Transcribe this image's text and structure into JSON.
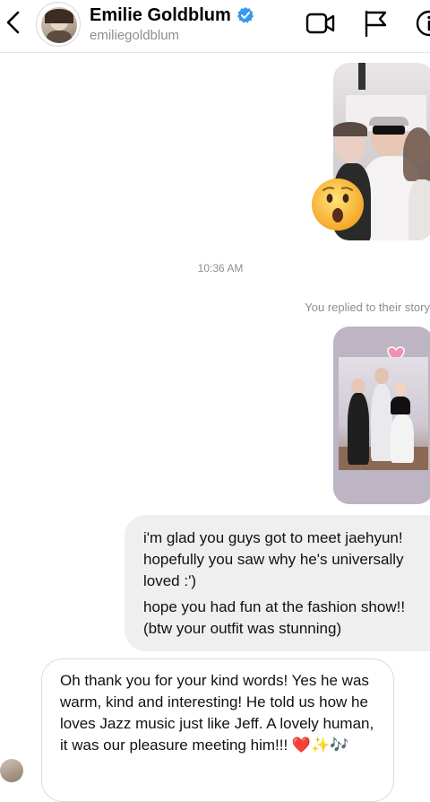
{
  "header": {
    "name": "Emilie Goldblum",
    "handle": "emiliegoldblum",
    "icons": [
      "back-chevron-icon",
      "verified-badge-icon",
      "video-call-icon",
      "flag-icon",
      "info-icon"
    ]
  },
  "thread": {
    "reaction_emoji": "surprised-face",
    "timestamp": "10:36 AM",
    "replied_label": "You replied to their story",
    "outgoing_message": [
      "i'm glad you guys got to meet jaehyun!",
      "hopefully you saw why he's universally",
      "loved :')",
      "hope you had fun at the fashion show!!",
      "(btw your outfit was stunning)"
    ],
    "incoming_message": "Oh thank you for your kind words! Yes he was warm, kind and interesting! He told us how he loves Jazz music just like Jeff. A lovely human, it was our pleasure meeting him!!! ❤️✨🎶"
  },
  "colors": {
    "verified_blue": "#3897f0",
    "bubble_gray": "#efefef",
    "meta_text": "#8e8e8e"
  }
}
